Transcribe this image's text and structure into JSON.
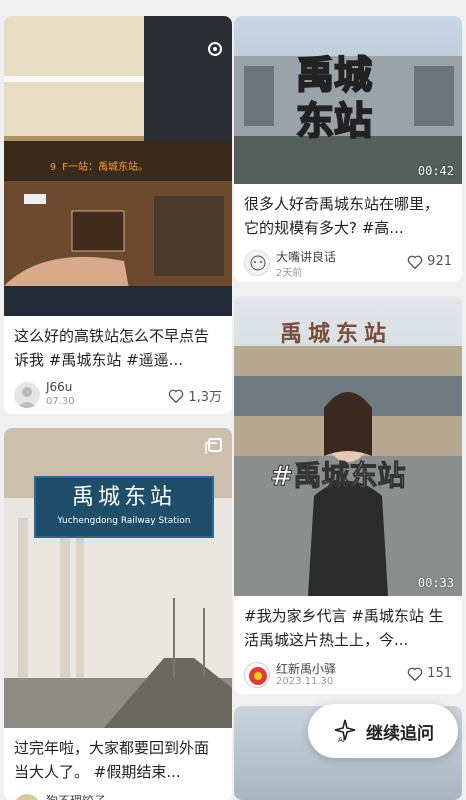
{
  "feed": {
    "left": [
      {
        "title": "这么好的高铁站怎么不早点告诉我 #禹城东站 #遥遥...",
        "author": "J66u",
        "date": "07.30",
        "likes": "1,3万",
        "overlay_text": "9  F一站：禹城东站。",
        "type": "photo"
      },
      {
        "title": "过完年啦，大家都要回到外面当大人了。 #假期结束...",
        "author": "狗不理饺子",
        "date": "",
        "likes": "",
        "sign_text": "禹城东站",
        "sign_sub": "Yuchengdong Railway Station",
        "type": "gallery"
      }
    ],
    "right": [
      {
        "title": "很多人好奇禹城东站在哪里，它的规模有多大? #高...",
        "author": "大嘴讲良话",
        "date": "2天前",
        "likes": "921",
        "big_text_1": "禹城",
        "big_text_2": "东站",
        "duration": "00:42",
        "type": "video"
      },
      {
        "title": "#我为家乡代言 #禹城东站 生活禹城这片热土上，今...",
        "author": "红新禹小驿",
        "date": "2023.11.30",
        "likes": "151",
        "station_sign": "禹城东站",
        "hashtag_overlay": "#禹城东站",
        "duration": "00:33",
        "type": "video"
      }
    ]
  },
  "continue_button": {
    "label": "继续追问"
  },
  "colors": {
    "accent_yellow": "#f5d020",
    "sign_teal": "#1f4e6b",
    "white": "#ffffff"
  }
}
